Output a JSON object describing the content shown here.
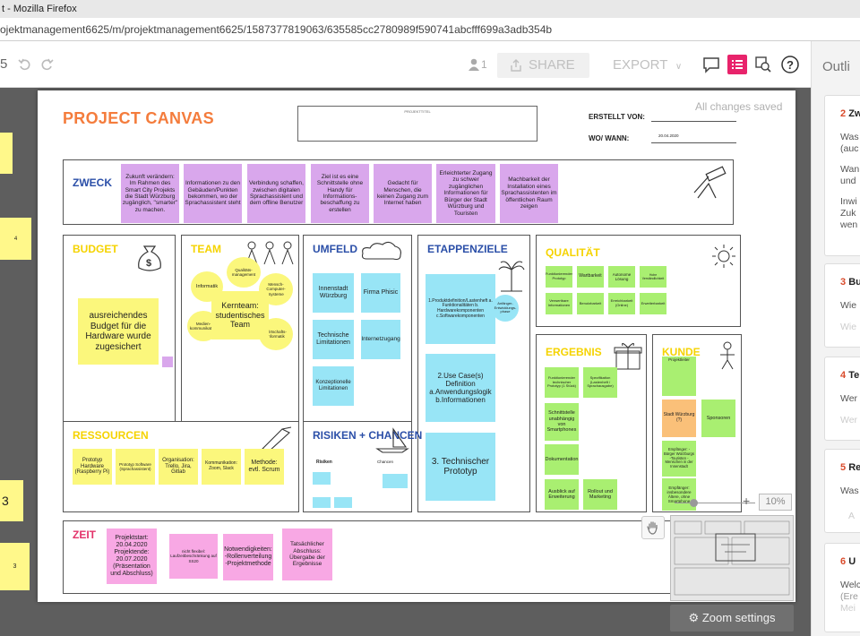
{
  "window": {
    "title": "t - Mozilla Firefox",
    "url": "ojektmanagement6625/m/projektmanagement6625/1587377819063/635585cc2780989f590741abcfff699a3adb354b"
  },
  "toolbar": {
    "zoom_fragment": "5",
    "user_count": "1",
    "share_label": "SHARE",
    "export_label": "EXPORT",
    "help_label": "?"
  },
  "outline": {
    "title": "Outli",
    "cards": [
      {
        "num": "2",
        "heading": "Zw",
        "lines": [
          "Was",
          "(auc",
          "Wan",
          "und",
          "Inwi",
          "Zuk",
          "wen"
        ]
      },
      {
        "num": "3",
        "heading": "Bu",
        "lines": [
          "Wie",
          "Wie"
        ]
      },
      {
        "num": "4",
        "heading": "Te",
        "lines": [
          "Wer",
          "Wer"
        ]
      },
      {
        "num": "5",
        "heading": "Re",
        "lines": [
          "Was",
          "A"
        ]
      },
      {
        "num": "6",
        "heading": "U",
        "lines": [
          "Welc",
          "(Ere",
          "Mei"
        ]
      }
    ]
  },
  "left_stickies": [
    "4",
    "3",
    "3"
  ],
  "board": {
    "title": "PROJECT CANVAS",
    "title_box_text": "PROJEKTTITEL",
    "created_by_label": "ERSTELLT VON:",
    "when_label": "WO/ WANN:",
    "when_value": "20.04.2020",
    "saved_status": "All changes saved",
    "zweck": {
      "title": "ZWECK",
      "notes": [
        "Zukunft verändern: Im Rahmen des Smart City Projekts die Stadt Würzburg zugänglich, \"smarter\" zu machen.",
        "Informationen zu den Gebäuden/Punkten bekommen, wo der Sprachassistent steht",
        "Verbindung schaffen, zwischen digitalen Sprachassistent und dem offline Benutzer",
        "Ziel ist es eine Schnittstelle ohne Handy für Informations-beschaffung zu erstellen",
        "Gedacht für Menschen, die keinen Zugang zum Internet haben",
        "Erleichterter Zugang zu schwer zugänglichen Informationen für Bürger der Stadt Würzburg und Touristen",
        "Machbarkeit der Installation eines Sprachassistenten im öffentlichen Raum zeigen"
      ]
    },
    "budget": {
      "title": "BUDGET",
      "note": "ausreichendes Budget für die Hardware wurde zugesichert"
    },
    "team": {
      "title": "TEAM",
      "core": "Kernteam: studentisches Team",
      "bubbles": [
        "Informatik",
        "Qualitäts-management",
        "Mensch-Computer-Systeme",
        "Medien-kommunikation",
        "Wirtschafts-informatik"
      ]
    },
    "umfeld": {
      "title": "UMFELD",
      "notes": [
        "Innenstadt Würzburg",
        "Firma Phisic",
        "Technische Limitationen",
        "Internetzugang",
        "Konzeptionelle Limitationen"
      ]
    },
    "etappenziele": {
      "title": "ETAPPENZIELE",
      "notes": [
        "1.Produktdefinition/Lastenheft a. Funktionalitäten b. Hardwarekomponenten c.Softwarekomponenten",
        "2.Use Case(s) Definition a.Anwendungslogik b.Informationen",
        "3. Technischer Prototyp"
      ],
      "bubble": "Anfänger-Entwicklungs-phase"
    },
    "qualitaet": {
      "title": "QUALITÄT",
      "notes": [
        "Funktionierender Prototyp",
        "Wartbarkeit",
        "Autonome Lösung",
        "Hohe Verständlichkeit",
        "Verwertbare Informationen",
        "Benutzbarkeit",
        "Erreichbarkeit (Online)",
        "Erweiterbarkeit"
      ]
    },
    "ergebnis": {
      "title": "ERGEBNIS",
      "notes": [
        "Funktionierender technischer Prototyp (1 Stück)",
        "Spezifikation (Lastenheft / Sprachausgabe)",
        "Schnittstelle unabhängig von Smartphones",
        "Dokumentation",
        "Ausblick auf Erweiterung",
        "Rollout und Marketing"
      ]
    },
    "kunde": {
      "title": "KUNDE",
      "notes": [
        "Projektleiter",
        "Stadt Würzburg (?)",
        "Sponsoren",
        "Empfänger: -Bürger Würzburgs -Touristen -Menschen in der Innenstadt",
        "Empfänger: insbesondere Ältere, ohne Smartphone"
      ]
    },
    "ressourcen": {
      "title": "RESSOURCEN",
      "notes": [
        "Prototyp Hardware (Raspberry Pi)",
        "Prototyp Software (Sprachassistent)",
        "Organisation: Trello, Jira, Gitlab",
        "Kommunikation: Zoom, Slack",
        "Methode: evtl. Scrum"
      ]
    },
    "risiken": {
      "title": "RISIKEN + CHANCEN",
      "risiken_label": "Risiken",
      "chancen_label": "Chancen"
    },
    "zeit": {
      "title": "ZEIT",
      "notes": [
        "Projektstart: 20.04.2020 Projektende: 20.07.2020 (Präsentation und Abschluss)",
        "nicht flexibel: Laufzeitbeschränkung auf SS20",
        "Notwendigkeiten: -Rollenverteilung -Projektmethode",
        "Tatsächlicher Abschluss: Übergabe der Ergebnisse"
      ]
    }
  },
  "zoom": {
    "percent": "10%",
    "plus": "+",
    "settings_label": "Zoom settings",
    "level": 0.18
  },
  "colors": {
    "accent_orange": "#f47c3c",
    "zweck_blue": "#2b4fa8",
    "budget_yellow": "#f5d300"
  }
}
